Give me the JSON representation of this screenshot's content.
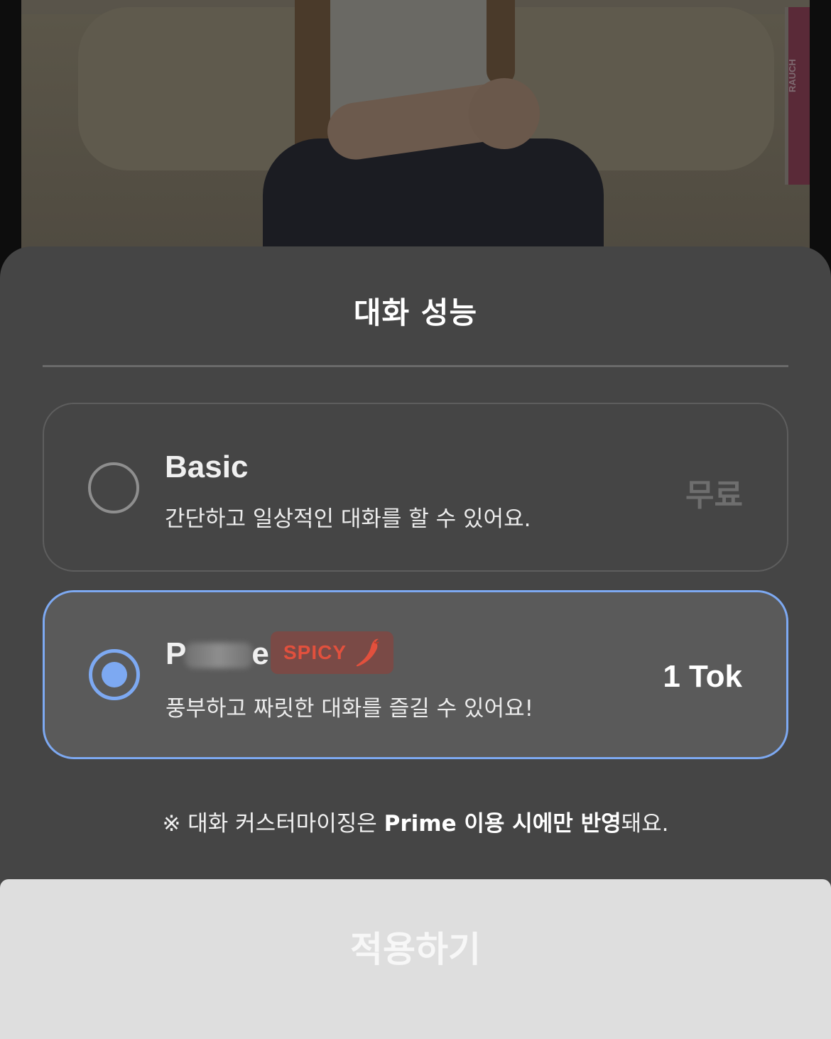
{
  "background": {
    "photo_book_label": "RAUCH"
  },
  "sheet": {
    "title": "대화 성능"
  },
  "options": [
    {
      "name": "Basic",
      "description": "간단하고 일상적인 대화를 할 수 있어요.",
      "price": "무료",
      "selected": false
    },
    {
      "name_visible_start": "P",
      "name_visible_end": "e",
      "badge": "SPICY",
      "badge_icon": "chili-pepper-icon",
      "description": "풍부하고 짜릿한 대화를 즐길 수 있어요!",
      "price": "1 Tok",
      "selected": true
    }
  ],
  "notice": {
    "prefix": "※ 대화 커스터마이징은 ",
    "bold": "Prime 이용 시에만 반영",
    "suffix": "돼요."
  },
  "apply_button": {
    "label": "적용하기"
  },
  "colors": {
    "sheet_bg": "#454545",
    "selected_accent": "#7da9f2",
    "spicy_red": "#e2503d",
    "button_bg": "#dedede"
  }
}
